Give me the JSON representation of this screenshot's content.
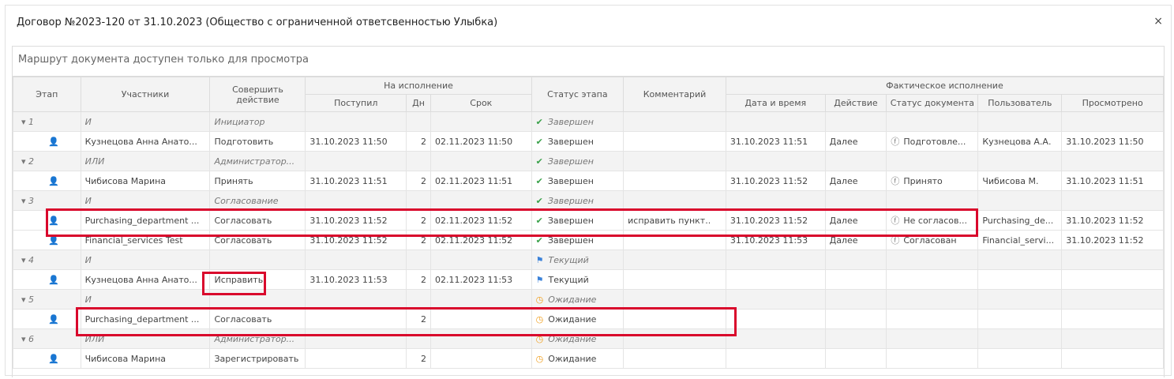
{
  "dialog": {
    "title": "Договор №2023-120 от 31.10.2023 (Общество с ограниченной ответсвенностью Улыбка)",
    "close_label": "×",
    "notice": "Маршрут документа доступен только для просмотра"
  },
  "table": {
    "group_headers": {
      "execution": "На исполнение",
      "actual": "Фактическое исполнение"
    },
    "headers": {
      "stage": "Этап",
      "participants": "Участники",
      "action": "Совершить действие",
      "received": "Поступил",
      "days": "Дн",
      "deadline": "Срок",
      "stage_status": "Статус этапа",
      "comment": "Комментарий",
      "datetime": "Дата и время",
      "act": "Действие",
      "doc_status": "Статус документа",
      "user": "Пользователь",
      "viewed": "Просмотрено"
    },
    "rows": [
      {
        "type": "stage",
        "stage": "1",
        "participants": "И",
        "action": "Инициатор",
        "received": "",
        "days": "",
        "deadline": "",
        "status_icon": "check-icon",
        "status": "Завершен",
        "comment": "",
        "datetime": "",
        "act": "",
        "doc_status_icon": "",
        "doc_status": "",
        "user": "",
        "viewed": ""
      },
      {
        "type": "participant",
        "stage": "",
        "participants": "Кузнецова Анна Анато...",
        "action": "Подготовить",
        "received": "31.10.2023 11:50",
        "days": "2",
        "deadline": "02.11.2023 11:50",
        "status_icon": "check-icon",
        "status": "Завершен",
        "comment": "",
        "datetime": "31.10.2023 11:51",
        "act": "Далее",
        "doc_status_icon": "lightning-circle-icon",
        "doc_status": "Подготовле...",
        "user": "Кузнецова А.А.",
        "viewed": "31.10.2023 11:50"
      },
      {
        "type": "stage",
        "stage": "2",
        "participants": "ИЛИ",
        "action": "Администратор...",
        "received": "",
        "days": "",
        "deadline": "",
        "status_icon": "check-icon",
        "status": "Завершен",
        "comment": "",
        "datetime": "",
        "act": "",
        "doc_status_icon": "",
        "doc_status": "",
        "user": "",
        "viewed": ""
      },
      {
        "type": "participant",
        "stage": "",
        "participants": "Чибисова Марина",
        "action": "Принять",
        "received": "31.10.2023 11:51",
        "days": "2",
        "deadline": "02.11.2023 11:51",
        "status_icon": "check-icon",
        "status": "Завершен",
        "comment": "",
        "datetime": "31.10.2023 11:52",
        "act": "Далее",
        "doc_status_icon": "lightning-circle-icon",
        "doc_status": "Принято",
        "user": "Чибисова М.",
        "viewed": "31.10.2023 11:51"
      },
      {
        "type": "stage",
        "stage": "3",
        "participants": "И",
        "action": "Согласование",
        "received": "",
        "days": "",
        "deadline": "",
        "status_icon": "check-icon",
        "status": "Завершен",
        "comment": "",
        "datetime": "",
        "act": "",
        "doc_status_icon": "",
        "doc_status": "",
        "user": "",
        "viewed": ""
      },
      {
        "type": "participant",
        "stage": "",
        "participants": "Purchasing_department ...",
        "action": "Согласовать",
        "received": "31.10.2023 11:52",
        "days": "2",
        "deadline": "02.11.2023 11:52",
        "status_icon": "check-icon",
        "status": "Завершен",
        "comment": "исправить пункт..",
        "datetime": "31.10.2023 11:52",
        "act": "Далее",
        "doc_status_icon": "lightning-circle-icon",
        "doc_status": "Не согласов...",
        "user": "Purchasing_de...",
        "viewed": "31.10.2023 11:52"
      },
      {
        "type": "participant",
        "stage": "",
        "participants": "Financial_services Test",
        "action": "Согласовать",
        "received": "31.10.2023 11:52",
        "days": "2",
        "deadline": "02.11.2023 11:52",
        "status_icon": "check-icon",
        "status": "Завершен",
        "comment": "",
        "datetime": "31.10.2023 11:53",
        "act": "Далее",
        "doc_status_icon": "lightning-circle-icon",
        "doc_status": "Согласован",
        "user": "Financial_servi...",
        "viewed": "31.10.2023 11:52"
      },
      {
        "type": "stage",
        "stage": "4",
        "participants": "И",
        "action": "",
        "received": "",
        "days": "",
        "deadline": "",
        "status_icon": "flag-icon",
        "status": "Текущий",
        "comment": "",
        "datetime": "",
        "act": "",
        "doc_status_icon": "",
        "doc_status": "",
        "user": "",
        "viewed": ""
      },
      {
        "type": "participant",
        "stage": "",
        "participants": "Кузнецова Анна Анато...",
        "action": "Исправить",
        "received": "31.10.2023 11:53",
        "days": "2",
        "deadline": "02.11.2023 11:53",
        "status_icon": "flag-icon",
        "status": "Текущий",
        "comment": "",
        "datetime": "",
        "act": "",
        "doc_status_icon": "",
        "doc_status": "",
        "user": "",
        "viewed": ""
      },
      {
        "type": "stage",
        "stage": "5",
        "participants": "И",
        "action": "",
        "received": "",
        "days": "",
        "deadline": "",
        "status_icon": "clock-icon",
        "status": "Ожидание",
        "comment": "",
        "datetime": "",
        "act": "",
        "doc_status_icon": "",
        "doc_status": "",
        "user": "",
        "viewed": ""
      },
      {
        "type": "participant",
        "stage": "",
        "participants": "Purchasing_department ...",
        "action": "Согласовать",
        "received": "",
        "days": "2",
        "deadline": "",
        "status_icon": "clock-icon",
        "status": "Ожидание",
        "comment": "",
        "datetime": "",
        "act": "",
        "doc_status_icon": "",
        "doc_status": "",
        "user": "",
        "viewed": ""
      },
      {
        "type": "stage",
        "stage": "6",
        "participants": "ИЛИ",
        "action": "Администратор...",
        "received": "",
        "days": "",
        "deadline": "",
        "status_icon": "clock-icon",
        "status": "Ожидание",
        "comment": "",
        "datetime": "",
        "act": "",
        "doc_status_icon": "",
        "doc_status": "",
        "user": "",
        "viewed": ""
      },
      {
        "type": "participant",
        "stage": "",
        "participants": "Чибисова Марина",
        "action": "Зарегистрировать",
        "received": "",
        "days": "2",
        "deadline": "",
        "status_icon": "clock-icon",
        "status": "Ожидание",
        "comment": "",
        "datetime": "",
        "act": "",
        "doc_status_icon": "",
        "doc_status": "",
        "user": "",
        "viewed": ""
      }
    ]
  },
  "colors": {
    "highlight": "#d9082c",
    "status_done": "#3aa14a",
    "status_current": "#3b82d9",
    "status_waiting": "#f0a020"
  }
}
